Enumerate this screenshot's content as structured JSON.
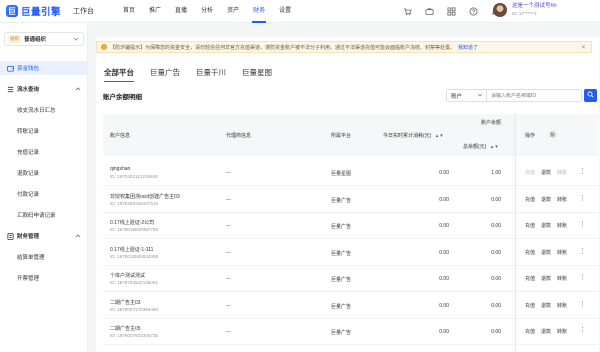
{
  "brand": {
    "logo": "巨",
    "name": "巨量引擎",
    "workspace": "工作台"
  },
  "nav": [
    {
      "label": "首页",
      "active": false
    },
    {
      "label": "推广",
      "active": false
    },
    {
      "label": "直播",
      "active": false
    },
    {
      "label": "分析",
      "active": false
    },
    {
      "label": "资产",
      "active": false
    },
    {
      "label": "财务",
      "active": true
    },
    {
      "label": "设置",
      "active": false
    }
  ],
  "user": {
    "name": "这是一个测试号hh",
    "id": "ID: 17******1"
  },
  "org": {
    "tag": "组织",
    "name": "普通组织"
  },
  "sidebar": {
    "items": [
      {
        "label": "资金钱包",
        "type": "top",
        "active": true,
        "icon": "wallet-icon"
      },
      {
        "label": "流水查询",
        "type": "group",
        "icon": "list-icon"
      },
      {
        "label": "收支流水日汇总",
        "type": "sub"
      },
      {
        "label": "转账记录",
        "type": "sub"
      },
      {
        "label": "充值记录",
        "type": "sub"
      },
      {
        "label": "退款记录",
        "type": "sub"
      },
      {
        "label": "付款记录",
        "type": "sub"
      },
      {
        "label": "汇款码申请记录",
        "type": "sub"
      },
      {
        "label": "财务管理",
        "type": "group",
        "icon": "finance-icon"
      },
      {
        "label": "结算单管理",
        "type": "sub"
      },
      {
        "label": "开票管理",
        "type": "sub"
      }
    ]
  },
  "notice": {
    "text": "【防诈骗提示】为保障您的资金安全，请勿轻信任何非官方充值渠道，谨防资金账户被不法分子利用，通过不法渠道充值可能会面临账户冻结、封禁等处置。",
    "link": "我知道了"
  },
  "tabs": [
    "全部平台",
    "巨量广告",
    "巨量千川",
    "巨量星图"
  ],
  "section_title": "账户余额明细",
  "filter": {
    "select": "账户",
    "placeholder": "请输入账户名称或ID"
  },
  "table": {
    "headers": {
      "account": "账户信息",
      "agent": "代理商信息",
      "platform": "所属平台",
      "consume": "今日实时累计消耗(元)",
      "balance_group": "账户余额",
      "total": "总余额(元)",
      "ops": "操作"
    },
    "rows": [
      {
        "name": "qingshan",
        "id": "ID: 1670452112236559",
        "agent": "---",
        "platform": "巨量星图",
        "consume": "0.00",
        "total": "1.00",
        "actions": [
          "充值",
          "退款",
          "转账"
        ],
        "disabled": [
          true,
          false,
          true
        ]
      },
      {
        "name": "非授权集团测ocid创建广告主03",
        "id": "ID: 1678269158447616",
        "agent": "---",
        "platform": "巨量广告",
        "consume": "0.00",
        "total": "0.00",
        "actions": [
          "充值",
          "退款",
          "转账"
        ],
        "disabled": [
          false,
          false,
          false
        ]
      },
      {
        "name": "0.17线上验证-2公司",
        "id": "ID: 1678018839387700",
        "agent": "---",
        "platform": "巨量广告",
        "consume": "0.00",
        "total": "0.00",
        "actions": [
          "充值",
          "退款",
          "转账"
        ],
        "disabled": [
          false,
          false,
          false
        ]
      },
      {
        "name": "0.17线上验证-1-111",
        "id": "ID: 1678018585934399",
        "agent": "---",
        "platform": "巨量广告",
        "consume": "0.00",
        "total": "0.00",
        "actions": [
          "充值",
          "退款",
          "转账"
        ],
        "disabled": [
          false,
          false,
          false
        ]
      },
      {
        "name": "个体户测试测试",
        "id": "ID: 1678783542146051",
        "agent": "---",
        "platform": "巨量广告",
        "consume": "0.00",
        "total": "0.00",
        "actions": [
          "充值",
          "退款",
          "转账"
        ],
        "disabled": [
          false,
          false,
          false
        ]
      },
      {
        "name": "二期广告主03",
        "id": "ID: 1679007370369490",
        "agent": "---",
        "platform": "巨量广告",
        "consume": "0.00",
        "total": "0.00",
        "actions": [
          "充值",
          "退款",
          "转账"
        ],
        "disabled": [
          false,
          false,
          false
        ]
      },
      {
        "name": "二期广告主05",
        "id": "ID: 1679007933306735",
        "agent": "---",
        "platform": "巨量广告",
        "consume": "0.00",
        "total": "0.00",
        "actions": [
          "充值",
          "退款",
          "转账"
        ],
        "disabled": [
          false,
          false,
          false
        ]
      }
    ]
  },
  "colors": {
    "accent": "#1f5bff",
    "notice_bg": "#fdf6e7",
    "org_tag": "#d9822b"
  }
}
